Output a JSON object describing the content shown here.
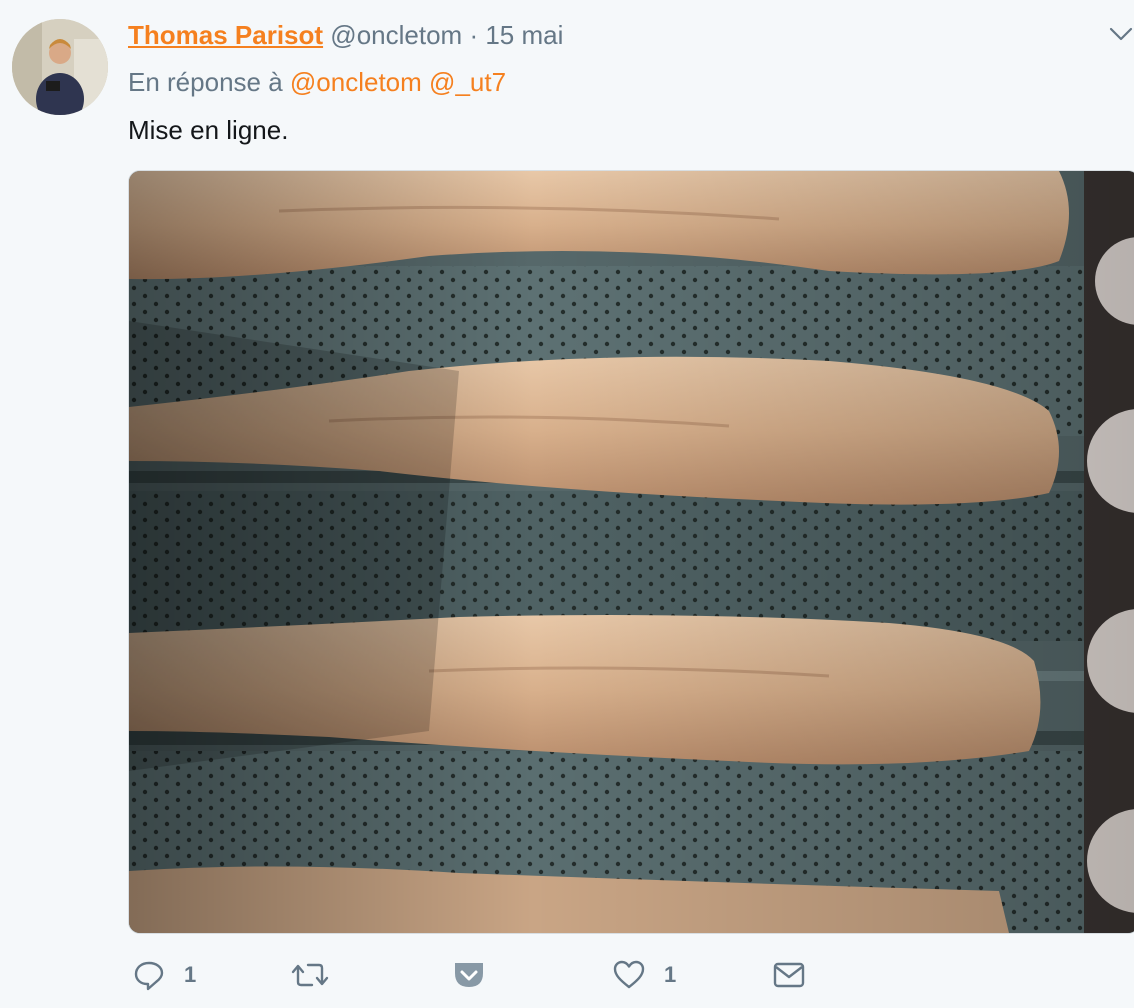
{
  "tweet": {
    "author_name": "Thomas Parisot",
    "handle": "@oncletom",
    "separator": "·",
    "date": "15 mai",
    "reply_prefix": "En réponse à",
    "reply_mentions": [
      "@oncletom",
      "@_ut7"
    ],
    "text": "Mise en ligne."
  },
  "actions": {
    "reply_count": "1",
    "like_count": "1"
  },
  "icons": {
    "reply": "reply-icon",
    "retweet": "retweet-icon",
    "bookmark": "pocket-icon",
    "like": "heart-icon",
    "dm": "envelope-icon",
    "menu": "chevron-down-icon"
  },
  "colors": {
    "accent": "#f5801f",
    "muted": "#657786",
    "background": "#f5f8fa"
  }
}
